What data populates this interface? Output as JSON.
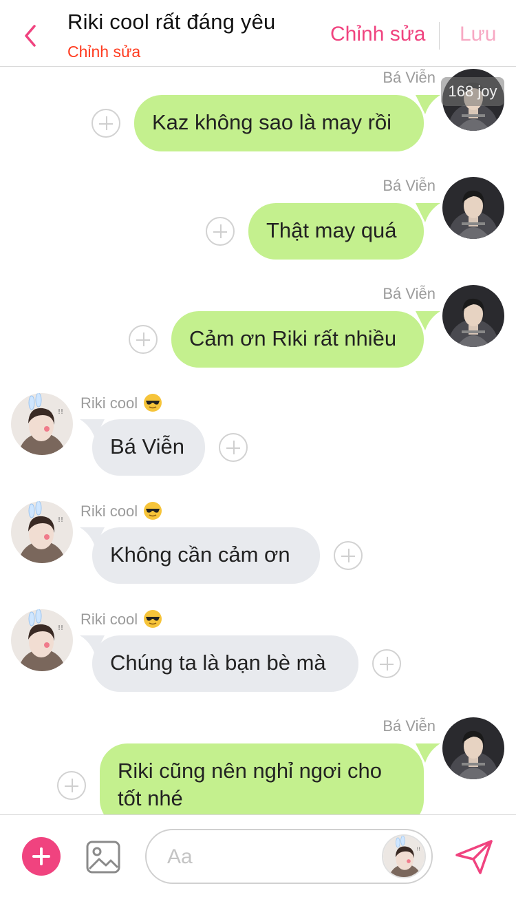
{
  "header": {
    "title": "Riki cool rất đáng yêu",
    "subtitle": "Chỉnh sửa",
    "edit_label": "Chỉnh sửa",
    "save_label": "Lưu"
  },
  "watermark": "168 joy",
  "messages": [
    {
      "sender": "Bá Viễn",
      "text": "Kaz không sao là may rồi",
      "direction": "outgoing"
    },
    {
      "sender": "Bá Viễn",
      "text": "Thật may quá",
      "direction": "outgoing"
    },
    {
      "sender": "Bá Viễn",
      "text": "Cảm ơn Riki rất nhiều",
      "direction": "outgoing"
    },
    {
      "sender": "Riki cool",
      "text": "Bá Viễn",
      "direction": "incoming"
    },
    {
      "sender": "Riki cool",
      "text": "Không cần cảm ơn",
      "direction": "incoming"
    },
    {
      "sender": "Riki cool",
      "text": "Chúng ta là bạn bè mà",
      "direction": "incoming"
    },
    {
      "sender": "Bá Viễn",
      "text_line1": "Riki cũng nên nghỉ ngơi cho",
      "text_line2": "tốt nhé",
      "direction": "outgoing"
    }
  ],
  "composer": {
    "placeholder": "Aa"
  },
  "colors": {
    "accent": "#f0437f",
    "outgoing_bubble": "#c4f08e",
    "incoming_bubble": "#e8eaee",
    "subtitle": "#ff3b1f"
  },
  "icons": [
    "back-chevron-icon",
    "plus-icon",
    "sunglasses-emoji-icon",
    "image-icon",
    "send-icon"
  ]
}
